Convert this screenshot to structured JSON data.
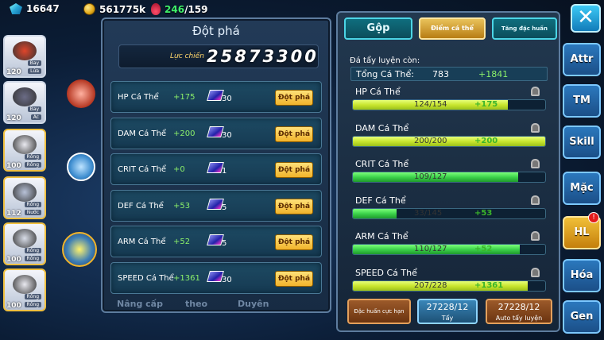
{
  "top": {
    "gems": "16647",
    "gold": "561775k",
    "stamina_cur": "246",
    "stamina_max": "/159"
  },
  "party": [
    {
      "level": "120",
      "tags": [
        "Bay",
        "Lửa"
      ],
      "color": "#e0452a"
    },
    {
      "level": "120",
      "tags": [
        "Bay",
        "Ác"
      ],
      "color": "#6b6c86"
    },
    {
      "level": "100",
      "tags": [
        "Rồng",
        "Rồng"
      ],
      "color": "#e9e9f0"
    },
    {
      "level": "112",
      "tags": [
        "Rồng",
        "Nước"
      ],
      "color": "#b8c2d8"
    },
    {
      "level": "100",
      "tags": [
        "Rồng",
        "Rồng"
      ],
      "color": "#d8dde8"
    },
    {
      "level": "100",
      "tags": [
        "Rồng",
        "Rồng"
      ],
      "color": "#e9e9f0"
    }
  ],
  "left_panel": {
    "title": "Đột phá",
    "power_label": "Lực chiến",
    "power_value": "25873300",
    "rows": [
      {
        "name": "HP Cá Thể",
        "bonus": "+175",
        "cost": "30",
        "button": "Đột phá"
      },
      {
        "name": "DAM Cá Thể",
        "bonus": "+200",
        "cost": "30",
        "button": "Đột phá"
      },
      {
        "name": "CRIT Cá Thể",
        "bonus": "+0",
        "cost": "1",
        "button": "Đột phá"
      },
      {
        "name": "DEF Cá Thể",
        "bonus": "+53",
        "cost": "5",
        "button": "Đột phá"
      },
      {
        "name": "ARM Cá Thể",
        "bonus": "+52",
        "cost": "5",
        "button": "Đột phá"
      },
      {
        "name": "SPEED Cá Thể",
        "bonus": "+1361",
        "cost": "30",
        "button": "Đột phá"
      }
    ],
    "bottom": [
      "Nâng cấp",
      "theo",
      "Duyên"
    ]
  },
  "right_panel": {
    "tabs": [
      "Gộp",
      "Điểm cá thể",
      "Tăng đặc huấn"
    ],
    "remaining_label": "Đá tẩy luyện còn:",
    "total": {
      "name": "Tổng Cá Thể:",
      "value": "783",
      "bonus": "+1841"
    },
    "stats": [
      {
        "name": "HP Cá Thể",
        "bar_text": "124/154",
        "bonus": "+175",
        "fill": 0.805,
        "color": "yellow"
      },
      {
        "name": "DAM Cá Thể",
        "bar_text": "200/200",
        "bonus": "+200",
        "fill": 1.0,
        "color": "yellow"
      },
      {
        "name": "CRIT Cá Thể",
        "bar_text": "109/127",
        "bonus": "",
        "fill": 0.858,
        "color": "green"
      },
      {
        "name": "DEF Cá Thể",
        "bar_text": "33/145",
        "bonus": "+53",
        "fill": 0.228,
        "color": "green"
      },
      {
        "name": "ARM Cá Thể",
        "bar_text": "110/127",
        "bonus": "+52",
        "fill": 0.866,
        "color": "green"
      },
      {
        "name": "SPEED Cá Thể",
        "bar_text": "207/228",
        "bonus": "+1361",
        "fill": 0.908,
        "color": "yellow"
      }
    ],
    "buttons": [
      {
        "top": "Đặc huấn cực hạn",
        "bottom": ""
      },
      {
        "top": "27228/12",
        "bottom": "Tẩy"
      },
      {
        "top": "27228/12",
        "bottom": "Auto tẩy luyện"
      }
    ]
  },
  "side_tabs": [
    "Attr",
    "TM",
    "Skill",
    "Mặc",
    "HL",
    "Hóa",
    "Gen"
  ],
  "side_tab_badge": "!",
  "close_label": "✕"
}
